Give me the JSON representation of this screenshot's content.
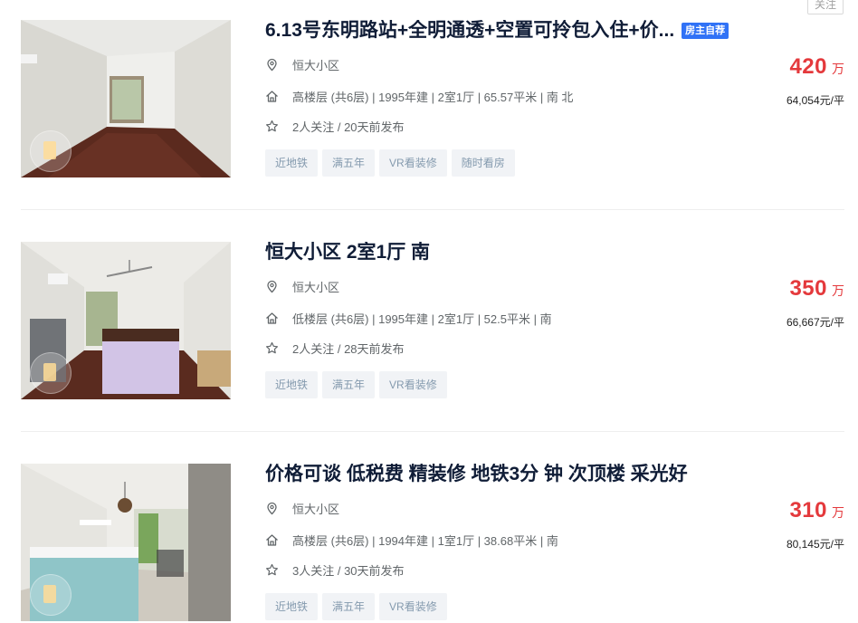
{
  "follow_button_label": "关注",
  "icons": {
    "location": "location-pin-icon",
    "house": "house-icon",
    "star": "star-icon"
  },
  "colors": {
    "price": "#e4393c",
    "owner_tag": "#3072f6",
    "title": "#101d37",
    "tag_bg": "#f1f3f6",
    "tag_text": "#849aae"
  },
  "listings": [
    {
      "title": "6.13号东明路站+全明通透+空置可拎包入住+价...",
      "owner_tag": "房主自荐",
      "community": "恒大小区",
      "house_info": "高楼层 (共6层) | 1995年建 | 2室1厅 | 65.57平米 | 南 北",
      "follow_info": "2人关注 / 20天前发布",
      "tags": [
        "近地铁",
        "满五年",
        "VR看装修",
        "随时看房"
      ],
      "price": "420",
      "price_unit": "万",
      "unit_price": "64,054元/平"
    },
    {
      "title": "恒大小区 2室1厅 南",
      "community": "恒大小区",
      "house_info": "低楼层 (共6层) | 1995年建 | 2室1厅 | 52.5平米 | 南",
      "follow_info": "2人关注 / 28天前发布",
      "tags": [
        "近地铁",
        "满五年",
        "VR看装修"
      ],
      "price": "350",
      "price_unit": "万",
      "unit_price": "66,667元/平"
    },
    {
      "title": "价格可谈 低税费 精装修 地铁3分 钟 次顶楼 采光好",
      "community": "恒大小区",
      "house_info": "高楼层 (共6层) | 1994年建 | 1室1厅 | 38.68平米 | 南",
      "follow_info": "3人关注 / 30天前发布",
      "tags": [
        "近地铁",
        "满五年",
        "VR看装修"
      ],
      "price": "310",
      "price_unit": "万",
      "unit_price": "80,145元/平"
    }
  ]
}
